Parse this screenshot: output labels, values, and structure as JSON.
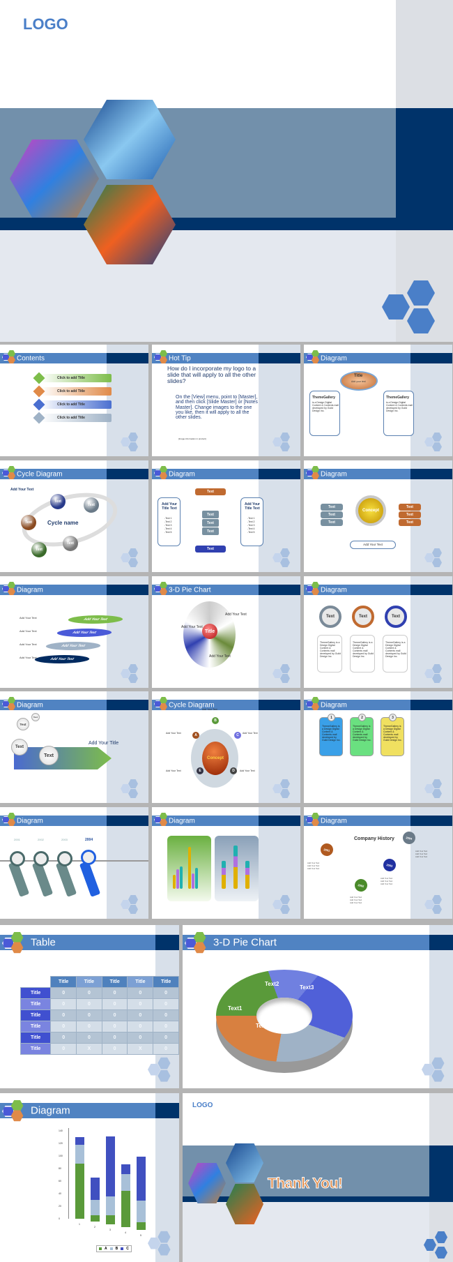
{
  "cover": {
    "logo": "LOGO"
  },
  "slides": {
    "contents": {
      "title": "Contents",
      "items": [
        {
          "n": "1",
          "label": "Click to add Title",
          "color": "#7dbd4a"
        },
        {
          "n": "2",
          "label": "Click to add Title",
          "color": "#e08a48"
        },
        {
          "n": "3",
          "label": "Click to add Title",
          "color": "#4a6fd0"
        },
        {
          "n": "4",
          "label": "Click to add Title",
          "color": "#9fb2c6"
        }
      ]
    },
    "hottip": {
      "title": "Hot Tip",
      "question": "How do I incorporate my logo to a slide that will apply to all the other slides?",
      "answer": "On the [View] menu, point to [Master], and then click [Slide Master] or [Notes Master]. Change images to the one you like, then it will apply to all the other slides.",
      "fine": "[Image information in product]"
    },
    "diagram1": {
      "title": "Diagram",
      "center_title": "Title",
      "center_sub": "Add your text",
      "box_title": "ThemeGallery",
      "box_text": "is a Design Digital Content & Contents mall developed by Guild Design Inc."
    },
    "cycle1": {
      "title": "Cycle Diagram",
      "add": "Add Your Text",
      "name": "Cycle name",
      "node": "Text"
    },
    "diagram2": {
      "title": "Diagram",
      "heading": "Add Your Title Text",
      "list": [
        "-Text 1",
        "-Text 2",
        "-Text 3",
        "-Text 4",
        "-Text 5"
      ],
      "node": "Text"
    },
    "diagram3": {
      "title": "Diagram",
      "concept": "Concept",
      "node": "Text",
      "add": "Add Your Text"
    },
    "diagram4": {
      "title": "Diagram",
      "add": "Add Your Text"
    },
    "pie1": {
      "title": "3-D Pie Chart",
      "center": "Title",
      "add": "Add Your Text"
    },
    "diagram5": {
      "title": "Diagram",
      "node": "Text",
      "text": "ThemeGallery is a Design Digital Content & Contents mall developed by Guild Design Inc."
    },
    "diagram6": {
      "title": "Diagram",
      "node": "Text",
      "add_title": "Add Your Title"
    },
    "cycle2": {
      "title": "Cycle Diagram",
      "concept": "Concept",
      "letters": [
        "A",
        "B",
        "C",
        "D",
        "E"
      ],
      "add": "Add Your Text"
    },
    "diagram7": {
      "title": "Diagram",
      "nums": [
        "1",
        "2",
        "3"
      ],
      "text": "ThemeGallery is a Design Digital Content & Contents mall developed by Guild Design Inc."
    },
    "diagram8": {
      "title": "Diagram",
      "years": [
        "2001",
        "2002",
        "2003",
        "2004"
      ],
      "tag": "Your Text"
    },
    "diagram9": {
      "title": "Diagram"
    },
    "diagram10": {
      "title": "Diagram",
      "heading": "Company History",
      "years": [
        "2001",
        "2002",
        "2003",
        "2004"
      ],
      "entry": "Add Your Text"
    },
    "table": {
      "title": "Table",
      "col_headers": [
        "Title",
        "Title",
        "Title",
        "Title",
        "Title"
      ],
      "rows": [
        {
          "h": "Title",
          "v": [
            "0",
            "0",
            "0",
            "0",
            "0"
          ]
        },
        {
          "h": "Title",
          "v": [
            "0",
            "0",
            "0",
            "0",
            "0"
          ]
        },
        {
          "h": "Title",
          "v": [
            "0",
            "0",
            "0",
            "0",
            "0"
          ]
        },
        {
          "h": "Title",
          "v": [
            "0",
            "0",
            "0",
            "0",
            "0"
          ]
        },
        {
          "h": "Title",
          "v": [
            "0",
            "0",
            "0",
            "0",
            "0"
          ]
        },
        {
          "h": "Title",
          "v": [
            "0",
            "X",
            "0",
            "X",
            "0"
          ]
        }
      ]
    },
    "pie2": {
      "title": "3-D Pie Chart",
      "labels": [
        "Text1",
        "Text2",
        "Text3",
        "Text4",
        "Text5"
      ]
    },
    "bars": {
      "title": "Diagram",
      "categories": [
        "1",
        "2",
        "3",
        "4",
        "5"
      ],
      "legend": [
        "A",
        "B",
        "C"
      ],
      "colors": [
        "#5a9a3a",
        "#a8c0d8",
        "#4050c0"
      ],
      "yticks": [
        "0",
        "20",
        "40",
        "60",
        "80",
        "100",
        "120",
        "140"
      ],
      "series": [
        {
          "name": "A",
          "values": [
            88,
            10,
            14,
            58,
            12
          ]
        },
        {
          "name": "B",
          "values": [
            30,
            24,
            30,
            27,
            35
          ]
        },
        {
          "name": "C",
          "values": [
            12,
            36,
            96,
            15,
            70
          ]
        }
      ]
    },
    "thanks": {
      "logo": "LOGO",
      "text": "Thank You!"
    }
  },
  "colors": {
    "header": "#5083c2",
    "navy": "#00336a",
    "sidebar": "#d8e0ea"
  }
}
